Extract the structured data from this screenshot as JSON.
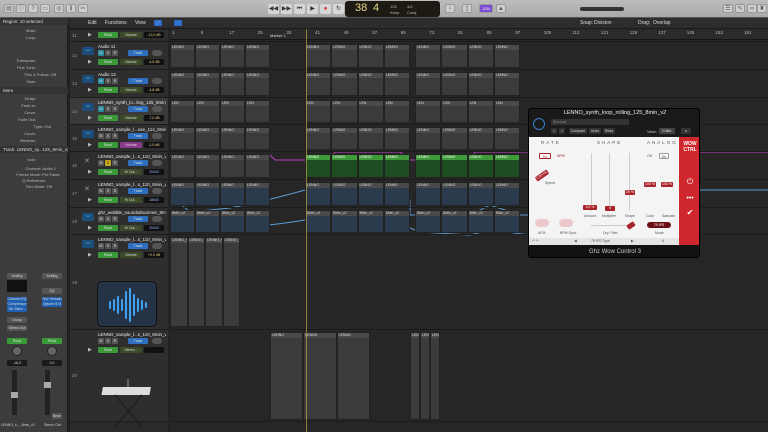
{
  "control_bar": {
    "lcd": {
      "bar": "38",
      "beat": "4",
      "tempo": "125",
      "tempo_label": "Keep",
      "time_sig": "4/4",
      "key": "Cmaj"
    },
    "cpu_badge": "1234",
    "transport": [
      "rewind",
      "fast-forward",
      "go-to-start",
      "play",
      "record",
      "cycle"
    ]
  },
  "local_bar": {
    "menus": [
      "Edit",
      "Functions",
      "View"
    ],
    "snap_label": "Snap:",
    "snap_value": "Division",
    "drag_label": "Drag:",
    "drag_value": "Overlap"
  },
  "ruler": {
    "ticks": [
      "1",
      "9",
      "17",
      "25",
      "33",
      "41",
      "49",
      "57",
      "65",
      "73",
      "81",
      "89",
      "97",
      "105",
      "113",
      "121",
      "129",
      "137",
      "145",
      "153",
      "161"
    ],
    "marker": "Marker 1"
  },
  "inspector": {
    "region_header": "Region: 10 selected",
    "region_rows": [
      "Mute:",
      "Loop:",
      "Transpose:",
      "Fine Tune:",
      "Flex & Follow: Off",
      "Gain:"
    ],
    "more_header": "More",
    "more_rows": [
      "Delay:",
      "Fade In:",
      "Curve:",
      "Fade Out:",
      "Type: Out",
      "Curve:",
      "Reverse:"
    ],
    "track_header": "Track: LENNO_sy...125_8min_v2",
    "track_rows": [
      "Icon:",
      "Channel: Audio 1",
      "Freeze Mode: Pre Fader",
      "Q-Reference:",
      "Flex Mode: Off"
    ],
    "strip1": {
      "setting": "Setting",
      "plugins": [
        "Channel EQ",
        "Compressor",
        "Gtr Stere..."
      ],
      "group": "Group",
      "output": "Stereo Out",
      "auto": "Read",
      "value": "-16,0",
      "name": "LENNO_s..._8min_v2"
    },
    "strip2": {
      "setting": "Setting",
      "eq": "EQ",
      "plugins": [
        "Ghz Versatu",
        "Optone 8 III"
      ],
      "auto": "Read",
      "value": "0,0",
      "bounce": "Bnce",
      "name": "Stereo Out"
    }
  },
  "tracks": [
    {
      "num": "11",
      "name": "",
      "param": "Volume",
      "value": "-12,0 dB",
      "region": "LENNO"
    },
    {
      "num": "12",
      "name": "Audio 11",
      "param": "Volume",
      "value": "-4,5 dB",
      "region": "LENNO"
    },
    {
      "num": "13",
      "name": "Audio 13",
      "param": "Volume",
      "value": "-4,8 dB",
      "region": "LENNO"
    },
    {
      "num": "14",
      "name": "LENNO_synth_lo...ling_125_8min_v2",
      "param": "Volume",
      "value": "-7,0 dB",
      "region": "LEN"
    },
    {
      "num": "15",
      "name": "LENNO_sample_l...use_114_8min_v2",
      "param": "Volume",
      "value": "-1,5 dB",
      "region": "LENNO"
    },
    {
      "num": "16",
      "name": "LENNO_sample_l...s_110_8min_v2_2",
      "param": "Hi Cut...",
      "value": "20000",
      "region": "LENNO"
    },
    {
      "num": "17",
      "name": "LENNO_sample_l...s_110_8min_v2_2",
      "param": "Hi Cut...",
      "value": "18600",
      "region": "LENNO"
    },
    {
      "num": "18",
      "name": "ghz_wobble_soundsdrummer_8m",
      "param": "Hi Cut...",
      "value": "20000",
      "region": "8Min_v2"
    },
    {
      "num": "19",
      "name": "LENNO_sample_l...s_110_8min_v2_3",
      "param": "Volume",
      "value": "+0,0 dB",
      "region": "LENNO_sample_loop_rolling_125_8"
    },
    {
      "num": "20",
      "name": "LENNO_sample_l...s_110_8min_v2_3",
      "param": "Stereo...",
      "value": "",
      "region": "LENNO"
    }
  ],
  "track_buttons": {
    "mute": "M",
    "solo": "S",
    "rec": "R",
    "input": "I",
    "track": "Track",
    "read": "Read"
  },
  "plugin": {
    "title": "LENNO_synth_loop_rolling_125_8min_v2",
    "preset": "Manual",
    "nav": [
      "<",
      ">",
      "Compare",
      "Undo",
      "Redo"
    ],
    "view_label": "View:",
    "view_value": "Editor",
    "sections": [
      "RATE",
      "SHAPE",
      "ANALOG"
    ],
    "rate": {
      "hz": "Hz",
      "bpm": "BPM",
      "speed_value": "2,00 Hz",
      "speed_label": "Speed",
      "afm": "AFM",
      "bpm_sync": "BPM Sync"
    },
    "shape": {
      "amount_value": "3,0 %",
      "amount_label": "Amount",
      "mult_value": "5",
      "mult_label": "Multiplier",
      "shape_value": "25 %",
      "shape_label": "Shape",
      "drywet_label": "Dry / Wet"
    },
    "analog": {
      "off": "Off",
      "on": "On",
      "color_value": "100 %",
      "color_label": "Color",
      "sat_value": "100 %",
      "sat_label": "Saturate",
      "mode_value": "75 IPS",
      "mode_label": "Mode"
    },
    "footer_preset": "75 IPS Type",
    "footer_ab": "A",
    "brand": "WOW CTRL",
    "name": "Ghz Wow Control 3",
    "accent": "#d0262e"
  }
}
